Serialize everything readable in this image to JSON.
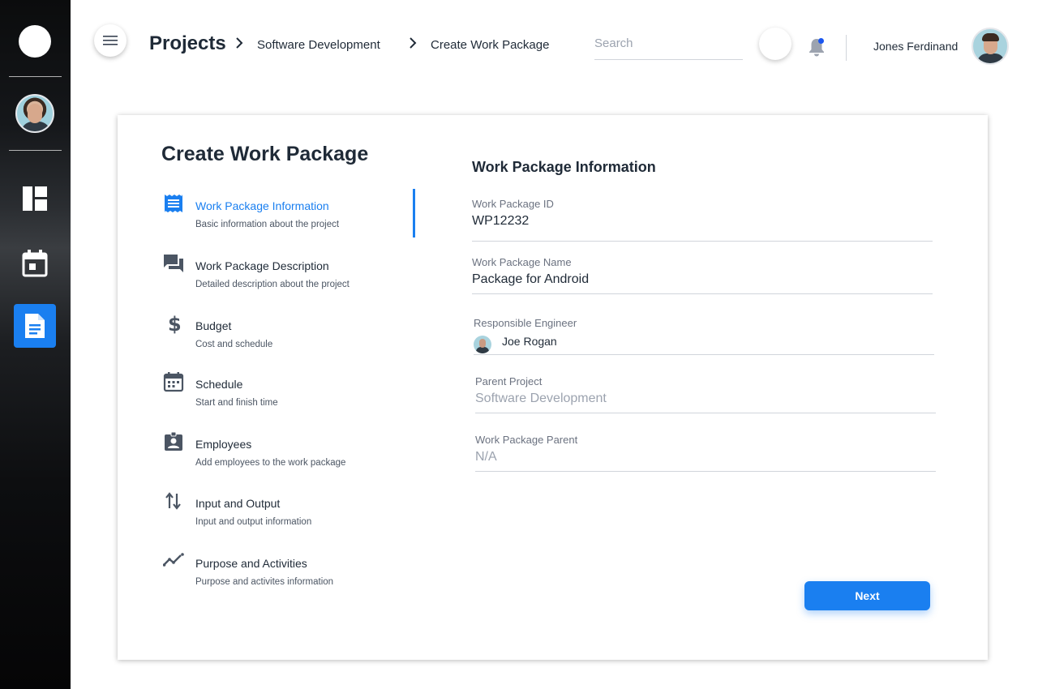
{
  "header": {
    "breadcrumb": [
      "Projects",
      "Software Development",
      "Create Work Package"
    ],
    "search_placeholder": "Search",
    "user_name": "Jones Ferdinand",
    "notification_dot_color": "#1a56f0"
  },
  "sidebar": {
    "items": [
      {
        "icon": "dashboard-icon"
      },
      {
        "icon": "calendar-icon"
      },
      {
        "icon": "document-icon",
        "active": true
      }
    ]
  },
  "page": {
    "title": "Create Work Package",
    "steps": [
      {
        "icon": "list-icon",
        "title": "Work Package Information",
        "subtitle": "Basic information about the project",
        "active": true
      },
      {
        "icon": "chat-icon",
        "title": "Work Package Description",
        "subtitle": "Detailed description about the project"
      },
      {
        "icon": "dollar-icon",
        "title": "Budget",
        "subtitle": "Cost and schedule"
      },
      {
        "icon": "calendar-icon",
        "title": "Schedule",
        "subtitle": "Start and finish time"
      },
      {
        "icon": "badge-icon",
        "title": "Employees",
        "subtitle": "Add employees to the work package"
      },
      {
        "icon": "swap-icon",
        "title": "Input and Output",
        "subtitle": "Input and output information"
      },
      {
        "icon": "trend-icon",
        "title": "Purpose and Activities",
        "subtitle": "Purpose and activites information"
      }
    ],
    "form": {
      "title": "Work Package Information",
      "fields": {
        "wp_id": {
          "label": "Work Package ID",
          "value": "WP12232"
        },
        "wp_name": {
          "label": "Work Package Name",
          "value": "Package for Android"
        },
        "engineer": {
          "label": "Responsible Engineer",
          "value": "Joe Rogan"
        },
        "parent_project": {
          "label": "Parent Project",
          "value": "Software Development"
        },
        "wp_parent": {
          "label": "Work Package Parent",
          "value": "N/A"
        }
      },
      "next_label": "Next"
    }
  },
  "colors": {
    "accent": "#1a7ff0"
  }
}
